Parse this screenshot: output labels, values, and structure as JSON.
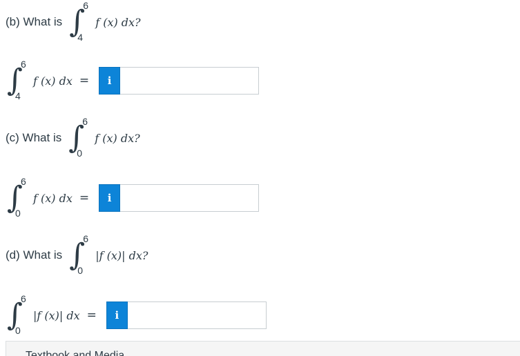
{
  "parts": [
    {
      "question": {
        "prefix": "(b) What is",
        "upper": "6",
        "lower": "4",
        "integrand": "f (x) dx?"
      },
      "answer": {
        "upper": "6",
        "lower": "4",
        "integrand": "f (x) dx",
        "equals": "=",
        "info_icon": "i",
        "value": "",
        "placeholder": ""
      }
    },
    {
      "question": {
        "prefix": "(c) What is",
        "upper": "6",
        "lower": "0",
        "integrand": "f (x) dx?"
      },
      "answer": {
        "upper": "6",
        "lower": "0",
        "integrand": "f (x) dx",
        "equals": "=",
        "info_icon": "i",
        "value": "",
        "placeholder": ""
      }
    },
    {
      "question": {
        "prefix": "(d) What is",
        "upper": "6",
        "lower": "0",
        "integrand": "|f (x)| dx?"
      },
      "answer": {
        "upper": "6",
        "lower": "0",
        "integrand": "|f (x)| dx",
        "equals": "=",
        "info_icon": "i",
        "value": "",
        "placeholder": ""
      }
    }
  ],
  "footer": {
    "label": "Textbook and Media"
  },
  "colors": {
    "accent": "#0d84d8",
    "text": "#2d3b45",
    "input_border": "#c7cdd1"
  }
}
